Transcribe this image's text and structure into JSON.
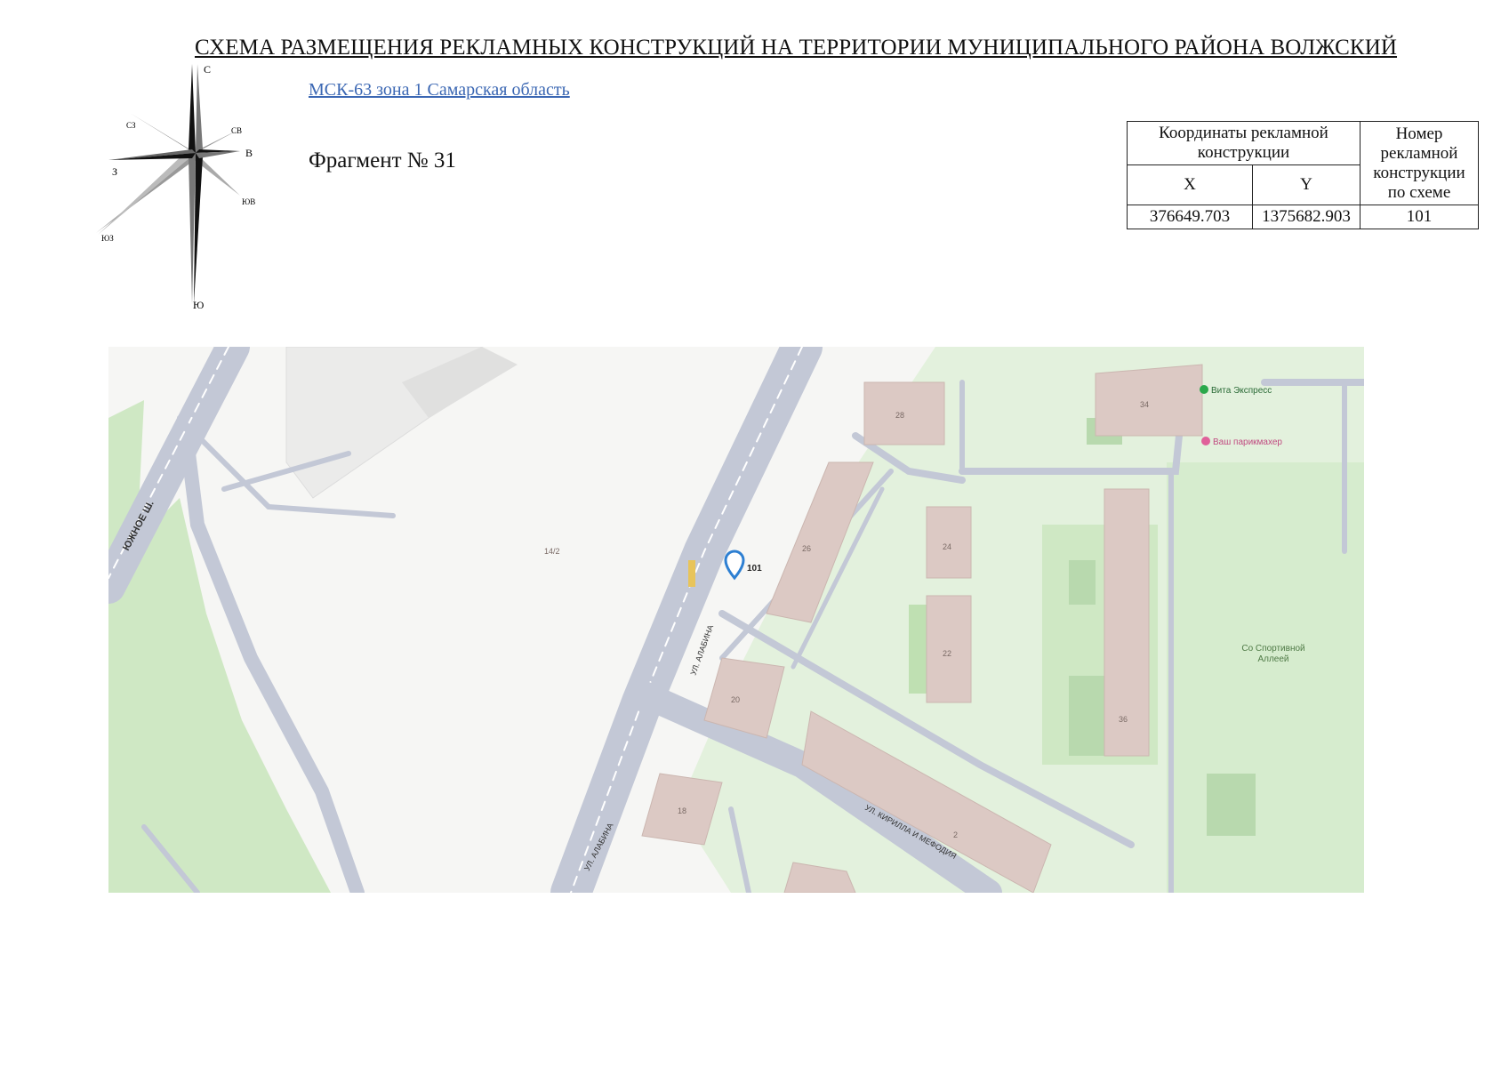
{
  "title": "СХЕМА РАЗМЕЩЕНИЯ РЕКЛАМНЫХ КОНСТРУКЦИЙ НА ТЕРРИТОРИИ МУНИЦИПАЛЬНОГО РАЙОНА ВОЛЖСКИЙ",
  "crs_link": "МСК-63 зона 1 Самарская область",
  "fragment": "Фрагмент № 31",
  "compass": {
    "n": "С",
    "s": "Ю",
    "e": "В",
    "w": "З",
    "ne": "СВ",
    "nw": "СЗ",
    "se": "ЮВ",
    "sw": "ЮЗ"
  },
  "table": {
    "header_coords": "Координаты рекламной конструкции",
    "header_number": "Номер рекламной конструкции по схеме",
    "col_x": "X",
    "col_y": "Y",
    "rows": [
      {
        "x": "376649.703",
        "y": "1375682.903",
        "number": "101"
      }
    ]
  },
  "map": {
    "marker_label": "101",
    "poi_vita": "Вита Экспресс",
    "poi_barber": "Ваш парикмахер",
    "park_line1": "Со Спортивной",
    "park_line2": "Аллеей",
    "street_yuzhnoe": "ЮЖНОЕ Ш.",
    "street_alabina": "УЛ. АЛАБИНА",
    "street_kirilla": "УЛ. КИРИЛЛА И МЕФОДИЯ",
    "buildings": [
      "28",
      "34",
      "26",
      "24",
      "22",
      "20",
      "36",
      "18",
      "2",
      "14/2"
    ],
    "colors": {
      "road": "#c3c8d6",
      "green": "#cfe8c4",
      "building": "#dcc9c4",
      "marker": "#2d7fd2",
      "poi_green": "#2aa84a",
      "poi_pink": "#e0609a"
    }
  }
}
